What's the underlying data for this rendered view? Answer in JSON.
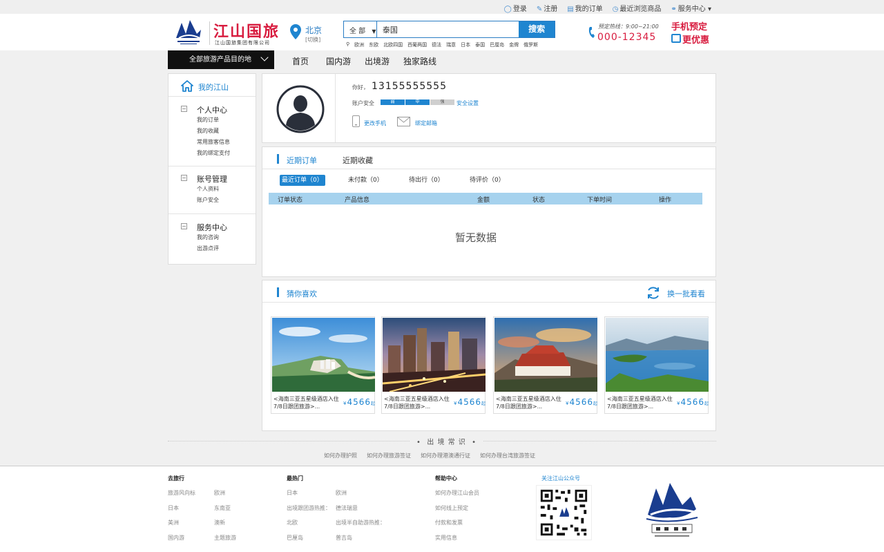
{
  "topbar": {
    "login": "登录",
    "register": "注册",
    "my_orders": "我的订单",
    "recent": "最近浏览商品",
    "service": "服务中心"
  },
  "header": {
    "logo_title": "江山国旅",
    "logo_sub": "江山国旅集团有限公司",
    "city": "北京",
    "city_switch": "[切换]",
    "search_category": "全 部",
    "search_value": "泰国",
    "search_button": "搜索",
    "hot_keywords": [
      "欧洲",
      "东欧",
      "北欧四国",
      "西葡两国",
      "德法",
      "瑞意",
      "日本",
      "泰国",
      "巴厘岛",
      "金牌",
      "俄罗斯"
    ],
    "hotline_label": "预定热线：9:00~21:00",
    "hotline_number": "000-12345",
    "promo_line1": "手机预定",
    "promo_line2": "更优惠"
  },
  "nav": {
    "all_destinations": "全部旅游产品目的地",
    "items": [
      "首页",
      "国内游",
      "出境游",
      "独家路线"
    ]
  },
  "sidebar": {
    "home": "我的江山",
    "groups": [
      {
        "title": "个人中心",
        "items": [
          "我的订单",
          "我的收藏",
          "常用旅客信息",
          "我的绑定支付"
        ]
      },
      {
        "title": "账号管理",
        "items": [
          "个人资料",
          "账户安全"
        ]
      },
      {
        "title": "服务中心",
        "items": [
          "我的咨询",
          "出游点评"
        ]
      }
    ]
  },
  "profile": {
    "greeting": "你好，",
    "phone": "13155555555",
    "security_label": "账户安全",
    "security_levels": [
      "弱",
      "中",
      "强"
    ],
    "security_level_current": 2,
    "security_link": "安全设置",
    "change_phone": "更改手机",
    "bind_email": "绑定邮箱"
  },
  "orders": {
    "tabs": [
      "近期订单",
      "近期收藏"
    ],
    "filters": [
      "最近订单（0）",
      "未付款（0）",
      "待出行（0）",
      "待评价（0）"
    ],
    "columns": [
      "订单状态",
      "产品信息",
      "金额",
      "状态",
      "下单时间",
      "操作"
    ],
    "empty": "暂无数据"
  },
  "guess": {
    "title": "猜你喜欢",
    "refresh": "换一批看看",
    "cards": [
      {
        "title": "<海南三亚五星级酒店入住7/8日跟团旅游>...",
        "currency": "¥",
        "price": "4566",
        "suffix": "起"
      },
      {
        "title": "<海南三亚五星级酒店入住7/8日跟团旅游>...",
        "currency": "¥",
        "price": "4566",
        "suffix": "起"
      },
      {
        "title": "<海南三亚五星级酒店入住7/8日跟团旅游>...",
        "currency": "¥",
        "price": "4566",
        "suffix": "起"
      },
      {
        "title": "<海南三亚五星级酒店入住7/8日跟团旅游>...",
        "currency": "¥",
        "price": "4566",
        "suffix": "起"
      }
    ]
  },
  "tips": {
    "title": "出 境 常 识",
    "links": [
      "如何办理护照",
      "如何办理旅游签证",
      "如何办理港澳通行证",
      "如何办理台湾旅游签证"
    ]
  },
  "footer": {
    "col1_title": "去旅行",
    "col1_links": [
      "旅游风向标",
      "欧洲",
      "日本",
      "东南亚",
      "美洲",
      "澳新",
      "国内游",
      "主题旅游"
    ],
    "col2_title": "最热门",
    "col2_links": [
      "日本",
      "欧洲",
      "出境跟团游热推：",
      "德法瑞意",
      "北欧",
      "出境半自助游热推：",
      "巴厘岛",
      "普吉岛"
    ],
    "col3_title": "帮助中心",
    "col3_links": [
      "如何办理江山会员",
      "如何线上预定",
      "付款和发票",
      "实用信息"
    ],
    "qr_title": "关注江山公众号"
  },
  "colors": {
    "brand_red": "#d81c3f",
    "accent_blue": "#1f85d0",
    "table_header": "#a6d2ee"
  }
}
